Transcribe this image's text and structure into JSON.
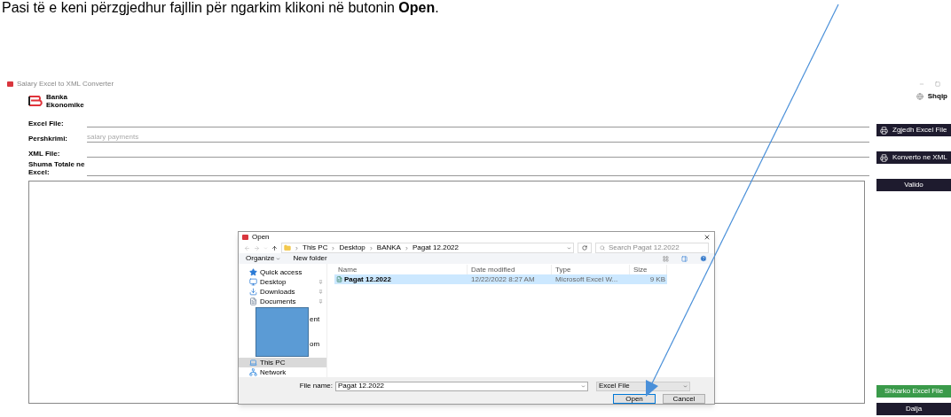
{
  "caption": "Pasi të e keni përzgjedhur fajllin për ngarkim klikoni në butonin **Open**.",
  "window": {
    "title": "Salary Excel to XML Converter"
  },
  "logo": {
    "line1": "Banka",
    "line2": "Ekonomike"
  },
  "language": "Shqip",
  "fields": [
    {
      "label": "Excel File:"
    },
    {
      "label": "Pershkrimi:",
      "placeholder": "salary payments"
    },
    {
      "label": "XML File:"
    },
    {
      "label": "Shuma Totale ne Excel:"
    }
  ],
  "actions": [
    {
      "label": "Zgjedh Excel File",
      "kind": "icon"
    },
    {
      "label": "Konverto ne XML",
      "kind": "icon"
    },
    {
      "label": "Valido",
      "kind": "plain"
    }
  ],
  "bottom_actions": [
    {
      "label": "Shkarko Excel File",
      "kind": "success"
    },
    {
      "label": "Dalja",
      "kind": "plain"
    }
  ],
  "dialog": {
    "title": "Open",
    "breadcrumbs": [
      "This PC",
      "Desktop",
      "BANKA",
      "Pagat 12.2022"
    ],
    "search": {
      "placeholder": "Search Pagat 12.2022"
    },
    "toolbar": [
      "Organize",
      "New folder"
    ],
    "nav": [
      {
        "label": "Quick access",
        "kind": "star",
        "selected": false,
        "pinned": false
      },
      {
        "label": "Desktop",
        "kind": "desktop",
        "selected": false,
        "pinned": true
      },
      {
        "label": "Downloads",
        "kind": "download",
        "selected": false,
        "pinned": true
      },
      {
        "label": "Documents",
        "kind": "document",
        "selected": false,
        "pinned": true
      },
      {
        "label": "ent",
        "kind": "covered",
        "selected": false
      },
      {
        "label": "om",
        "kind": "covered",
        "selected": false
      },
      {
        "label": "This PC",
        "kind": "pc",
        "selected": true,
        "pinned": false
      },
      {
        "label": "Network",
        "kind": "network",
        "selected": false,
        "pinned": false
      }
    ],
    "columns": [
      "Name",
      "Date modified",
      "Type",
      "Size"
    ],
    "rows": [
      {
        "cells": [
          "Pagat 12.2022",
          "12/22/2022 8:27 AM",
          "Microsoft Excel W...",
          "9 KB"
        ],
        "selected": true
      }
    ],
    "file_name_label": "File name:",
    "file_name": "Pagat 12.2022",
    "filter": "Excel File",
    "buttons": [
      "Open",
      "Cancel"
    ]
  }
}
